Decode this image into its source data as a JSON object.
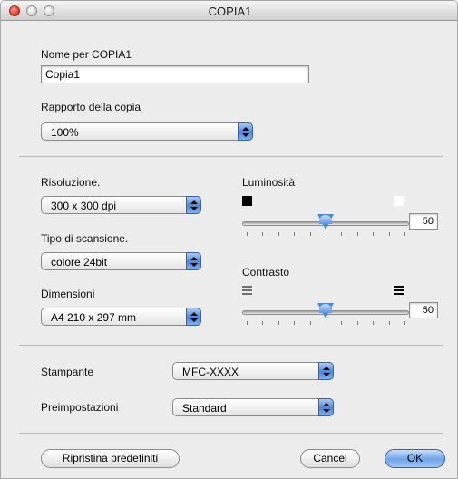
{
  "window": {
    "title": "COPIA1"
  },
  "name_section": {
    "label": "Nome per COPIA1",
    "value": "Copia1"
  },
  "ratio": {
    "label": "Rapporto della copia",
    "value": "100%"
  },
  "resolution": {
    "label": "Risoluzione.",
    "value": "300 x 300 dpi"
  },
  "scan_type": {
    "label": "Tipo di scansione.",
    "value": "colore 24bit"
  },
  "dimensions": {
    "label": "Dimensioni",
    "value": "A4 210 x 297 mm"
  },
  "brightness": {
    "label": "Luminosità",
    "value": "50",
    "level": 0.5
  },
  "contrast": {
    "label": "Contrasto",
    "value": "50",
    "level": 0.5
  },
  "printer": {
    "label": "Stampante",
    "value": "MFC-XXXX"
  },
  "presets": {
    "label": "Preimpostazioni",
    "value": "Standard"
  },
  "buttons": {
    "restore": "Ripristina predefiniti",
    "cancel": "Cancel",
    "ok": "OK"
  },
  "icons": {
    "close": "close-icon",
    "minimize": "minimize-icon",
    "zoom": "zoom-icon",
    "dark": "dark-square-icon",
    "light": "light-square-icon",
    "low_contrast": "low-contrast-icon",
    "high_contrast": "high-contrast-icon"
  },
  "colors": {
    "accent": "#4e86d9",
    "close_button": "#d6362a",
    "window_bg": "#ececec"
  }
}
